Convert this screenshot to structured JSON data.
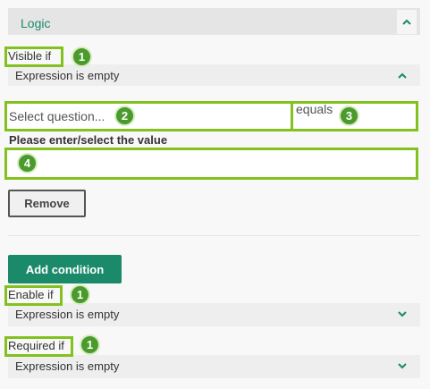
{
  "logic": {
    "title": "Logic"
  },
  "visible_if": {
    "label": "Visible if",
    "badge": "1",
    "expression": "Expression is empty"
  },
  "condition": {
    "question_placeholder": "Select question...",
    "question_badge": "2",
    "operator": "equals",
    "operator_badge": "3",
    "value_label": "Please enter/select the value",
    "value_badge": "4",
    "remove_label": "Remove"
  },
  "add_condition_label": "Add condition",
  "enable_if": {
    "label": "Enable if",
    "badge": "1",
    "expression": "Expression is empty"
  },
  "required_if": {
    "label": "Required if",
    "badge": "1",
    "expression": "Expression is empty"
  },
  "colors": {
    "accent": "#1a8a6a",
    "highlight": "#82c11e",
    "badge": "#4a9a2c"
  }
}
